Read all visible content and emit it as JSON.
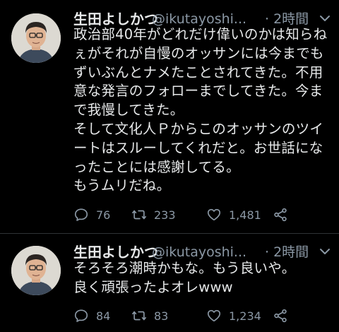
{
  "tweets": [
    {
      "display_name": "生田よしかつ",
      "handle": "@ikutayoshi...",
      "timestamp": "· 2時間",
      "text_lines": [
        "政治部40年がどれだけ偉いのかは知らね",
        "ぇがそれが自慢のオッサンには今までも",
        "ずいぶんとナメたことされてきた。不用",
        "意な発言のフォローまでしてきた。今ま",
        "で我慢してきた。",
        "そして文化人Ｐからこのオッサンのツイ",
        "ートはスルーしてくれだと。お世話にな",
        "ったことには感謝してる。",
        "もうムリだね。"
      ],
      "stats": {
        "replies": "76",
        "retweets": "233",
        "likes": "1,481"
      }
    },
    {
      "display_name": "生田よしかつ",
      "handle": "@ikutayoshi...",
      "timestamp": "· 2時間",
      "text_lines": [
        "そろそろ潮時かもな。もう良いや。",
        "良く頑張ったよオレwww"
      ],
      "stats": {
        "replies": "84",
        "retweets": "83",
        "likes": "1,234"
      }
    }
  ],
  "icons": {
    "more": "chevron-down-icon",
    "reply": "reply-icon",
    "retweet": "retweet-icon",
    "like": "heart-icon",
    "share": "share-icon"
  },
  "colors": {
    "background": "#000000",
    "text": "#e7e9ea",
    "secondary": "#8b98a5",
    "divider": "#2f3336"
  }
}
